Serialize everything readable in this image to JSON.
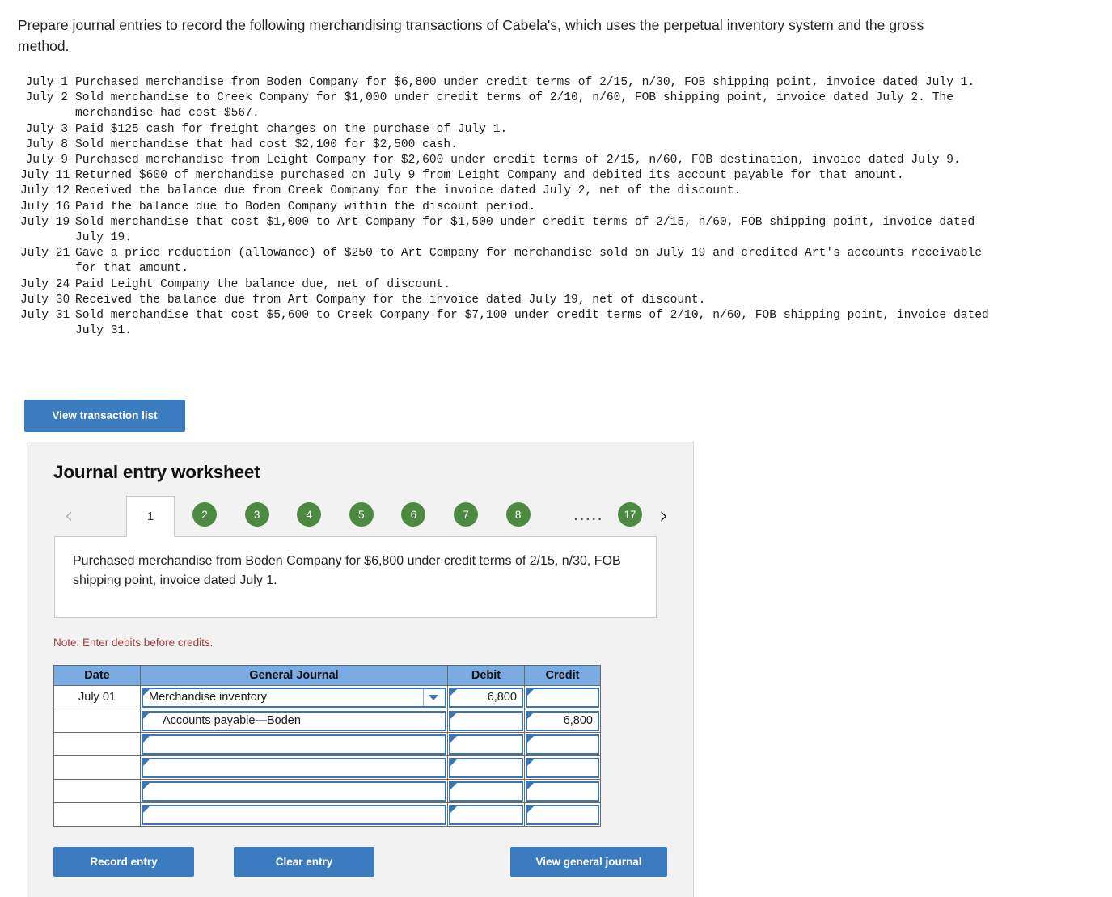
{
  "prompt": "Prepare journal entries to record the following merchandising transactions of Cabela's, which uses the perpetual inventory system and the gross method.",
  "transactions": [
    {
      "date": "July 1",
      "desc": "Purchased merchandise from Boden Company for $6,800 under credit terms of 2/15, n/30, FOB shipping point, invoice dated July 1."
    },
    {
      "date": "July 2",
      "desc": "Sold merchandise to Creek Company for $1,000 under credit terms of 2/10, n/60, FOB shipping point, invoice dated July 2. The merchandise had cost $567."
    },
    {
      "date": "July 3",
      "desc": "Paid $125 cash for freight charges on the purchase of July 1."
    },
    {
      "date": "July 8",
      "desc": "Sold merchandise that had cost $2,100 for $2,500 cash."
    },
    {
      "date": "July 9",
      "desc": "Purchased merchandise from Leight Company for $2,600 under credit terms of 2/15, n/60, FOB destination, invoice dated July 9."
    },
    {
      "date": "July 11",
      "desc": "Returned $600 of merchandise purchased on July 9 from Leight Company and debited its account payable for that amount."
    },
    {
      "date": "July 12",
      "desc": "Received the balance due from Creek Company for the invoice dated July 2, net of the discount."
    },
    {
      "date": "July 16",
      "desc": "Paid the balance due to Boden Company within the discount period."
    },
    {
      "date": "July 19",
      "desc": "Sold merchandise that cost $1,000 to Art Company for $1,500 under credit terms of 2/15, n/60, FOB shipping point, invoice dated July 19."
    },
    {
      "date": "July 21",
      "desc": "Gave a price reduction (allowance) of $250 to Art Company for merchandise sold on July 19 and credited Art's accounts receivable for that amount."
    },
    {
      "date": "July 24",
      "desc": "Paid Leight Company the balance due, net of discount."
    },
    {
      "date": "July 30",
      "desc": "Received the balance due from Art Company for the invoice dated July 19, net of discount."
    },
    {
      "date": "July 31",
      "desc": "Sold merchandise that cost $5,600 to Creek Company for $7,100 under credit terms of 2/10, n/60, FOB shipping point, invoice dated July 31."
    }
  ],
  "view_transaction_list_label": "View transaction list",
  "worksheet": {
    "title": "Journal entry worksheet",
    "prev_arrow": "‹",
    "next_arrow": "›",
    "active_tab": "1",
    "tabs": [
      "2",
      "3",
      "4",
      "5",
      "6",
      "7",
      "8"
    ],
    "ellipsis": ".....",
    "last_tab": "17",
    "description": "Purchased merchandise from Boden Company for $6,800 under credit terms of 2/15, n/30, FOB shipping point, invoice dated July 1.",
    "note": "Note: Enter debits before credits.",
    "columns": [
      "Date",
      "General Journal",
      "Debit",
      "Credit"
    ],
    "rows": [
      {
        "date": "July 01",
        "account": "Merchandise inventory",
        "indent": false,
        "dropdown": true,
        "debit": "6,800",
        "credit": ""
      },
      {
        "date": "",
        "account": "Accounts payable—Boden",
        "indent": true,
        "dropdown": false,
        "debit": "",
        "credit": "6,800"
      },
      {
        "date": "",
        "account": "",
        "indent": false,
        "dropdown": false,
        "debit": "",
        "credit": ""
      },
      {
        "date": "",
        "account": "",
        "indent": false,
        "dropdown": false,
        "debit": "",
        "credit": ""
      },
      {
        "date": "",
        "account": "",
        "indent": false,
        "dropdown": false,
        "debit": "",
        "credit": ""
      },
      {
        "date": "",
        "account": "",
        "indent": false,
        "dropdown": false,
        "debit": "",
        "credit": ""
      }
    ],
    "record_entry_label": "Record entry",
    "clear_entry_label": "Clear entry",
    "view_general_journal_label": "View general journal"
  },
  "colors": {
    "button_blue": "#3a7cbf",
    "tab_green": "#4c8a42",
    "table_header_blue": "#7aabe3",
    "note_red": "#a23a3a",
    "input_border_blue": "#3c74b4",
    "panel_bg": "#f2f2f2"
  }
}
